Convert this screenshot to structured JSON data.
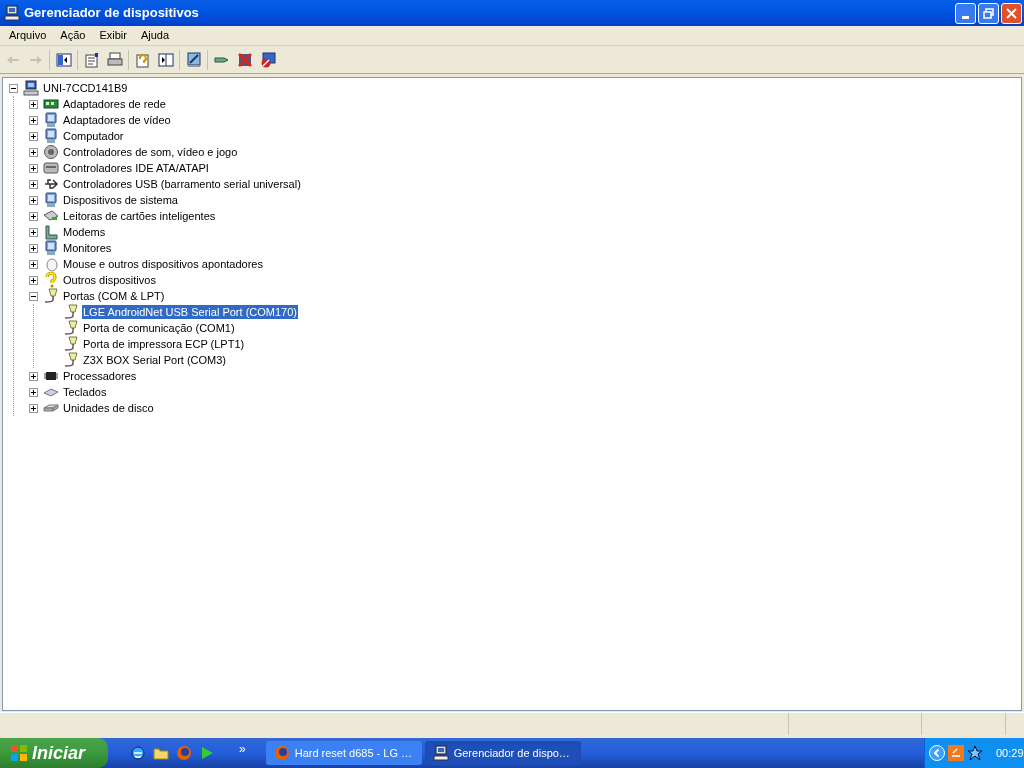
{
  "window": {
    "title": "Gerenciador de dispositivos"
  },
  "menu": [
    "Arquivo",
    "Ação",
    "Exibir",
    "Ajuda"
  ],
  "toolbar": [
    {
      "kind": "back",
      "disabled": true
    },
    {
      "kind": "forward",
      "disabled": true
    },
    {
      "kind": "sep"
    },
    {
      "kind": "tree",
      "disabled": false
    },
    {
      "kind": "sep"
    },
    {
      "kind": "properties",
      "disabled": false
    },
    {
      "kind": "print",
      "disabled": false
    },
    {
      "kind": "sep"
    },
    {
      "kind": "help",
      "disabled": false
    },
    {
      "kind": "pane",
      "disabled": false
    },
    {
      "kind": "sep"
    },
    {
      "kind": "scan",
      "disabled": false
    },
    {
      "kind": "sep"
    },
    {
      "kind": "update",
      "disabled": false
    },
    {
      "kind": "uninstall",
      "disabled": false
    },
    {
      "kind": "disable",
      "disabled": false
    }
  ],
  "tree": {
    "label": "UNI-7CCD141B9",
    "kind": "computer",
    "expanded": true,
    "selected": false,
    "children": [
      {
        "label": "Adaptadores de rede",
        "kind": "network",
        "expanded": false,
        "selected": false
      },
      {
        "label": "Adaptadores de vídeo",
        "kind": "display",
        "expanded": false,
        "selected": false
      },
      {
        "label": "Computador",
        "kind": "display",
        "expanded": false,
        "selected": false
      },
      {
        "label": "Controladores de som, vídeo e jogo",
        "kind": "sound",
        "expanded": false,
        "selected": false
      },
      {
        "label": "Controladores IDE ATA/ATAPI",
        "kind": "ide",
        "expanded": false,
        "selected": false
      },
      {
        "label": "Controladores USB (barramento serial universal)",
        "kind": "usb",
        "expanded": false,
        "selected": false
      },
      {
        "label": "Dispositivos de sistema",
        "kind": "display",
        "expanded": false,
        "selected": false
      },
      {
        "label": "Leitoras de cartões inteligentes",
        "kind": "smartcard",
        "expanded": false,
        "selected": false
      },
      {
        "label": "Modems",
        "kind": "modem",
        "expanded": false,
        "selected": false
      },
      {
        "label": "Monitores",
        "kind": "display",
        "expanded": false,
        "selected": false
      },
      {
        "label": "Mouse e outros dispositivos apontadores",
        "kind": "mouse",
        "expanded": false,
        "selected": false
      },
      {
        "label": "Outros dispositivos",
        "kind": "other",
        "expanded": false,
        "selected": false
      },
      {
        "label": "Portas (COM & LPT)",
        "kind": "port",
        "expanded": true,
        "selected": false,
        "children": [
          {
            "label": "LGE AndroidNet USB Serial Port (COM170)",
            "kind": "port",
            "selected": true
          },
          {
            "label": "Porta de comunicação (COM1)",
            "kind": "port",
            "selected": false
          },
          {
            "label": "Porta de impressora ECP (LPT1)",
            "kind": "port",
            "selected": false
          },
          {
            "label": "Z3X BOX Serial Port (COM3)",
            "kind": "port",
            "selected": false
          }
        ]
      },
      {
        "label": "Processadores",
        "kind": "cpu",
        "expanded": false,
        "selected": false
      },
      {
        "label": "Teclados",
        "kind": "keyboard",
        "expanded": false,
        "selected": false
      },
      {
        "label": "Unidades de disco",
        "kind": "disk",
        "expanded": false,
        "selected": false
      }
    ]
  },
  "taskbar": {
    "start": "Iniciar",
    "quick_launch_more": "»",
    "tasks": [
      {
        "label": "Hard reset d685 - LG …",
        "selected": false
      },
      {
        "label": "Gerenciador de dispo…",
        "selected": true
      }
    ],
    "clock": "00:29"
  }
}
